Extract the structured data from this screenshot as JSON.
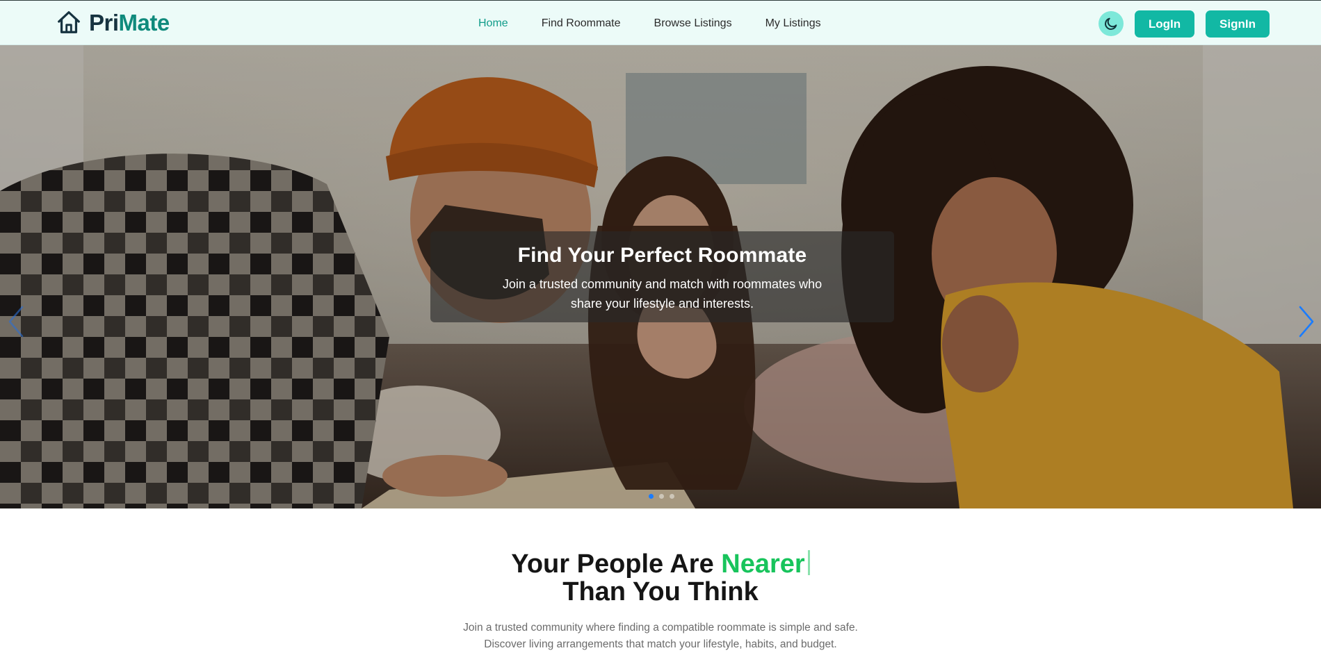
{
  "brand": {
    "name_part1": "Pri",
    "name_part2": "Mate",
    "icon": "house-icon"
  },
  "nav": {
    "links": [
      {
        "label": "Home",
        "active": true
      },
      {
        "label": "Find Roommate",
        "active": false
      },
      {
        "label": "Browse Listings",
        "active": false
      },
      {
        "label": "My Listings",
        "active": false
      }
    ],
    "theme_toggle_icon": "moon-icon",
    "login_label": "LogIn",
    "signin_label": "SignIn"
  },
  "hero": {
    "title": "Find Your Perfect Roommate",
    "subtitle": "Join a trusted community and match with roommates who share your lifestyle and interests.",
    "slide_count": 3,
    "active_slide": 1,
    "prev_icon": "chevron-left-icon",
    "next_icon": "chevron-right-icon"
  },
  "intro": {
    "heading_part1": "Your People Are ",
    "heading_highlight": "Nearer",
    "heading_line2": "Than You Think",
    "text": "Join a trusted community where finding a compatible roommate is simple and safe. Discover living arrangements that match your lifestyle, habits, and budget."
  },
  "colors": {
    "accent": "#12b8a4",
    "active_link": "#119c8a",
    "highlight_green": "#18c45c",
    "navbar_bg": "#ecfbf8",
    "dot_active": "#1a7cff"
  }
}
